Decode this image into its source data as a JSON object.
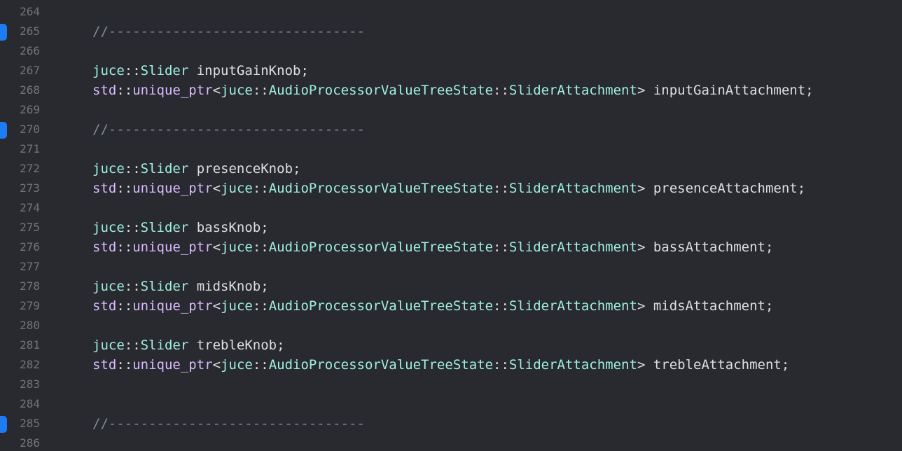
{
  "editor": {
    "colors": {
      "background": "#292a30",
      "line_number": "#747478",
      "change_marker": "#1c7cf4",
      "plain": "#dfdfe0",
      "namespace": "#a6e1ff",
      "std_namespace": "#dabaff",
      "type": "#9ef1dd",
      "comment": "#7f8c98"
    },
    "lines": [
      {
        "num": "264",
        "marker": false,
        "tokens": []
      },
      {
        "num": "265",
        "marker": true,
        "tokens": [
          {
            "t": "//--------------------------------",
            "c": "comment"
          }
        ]
      },
      {
        "num": "266",
        "marker": false,
        "tokens": []
      },
      {
        "num": "267",
        "marker": false,
        "tokens": [
          {
            "t": "juce",
            "c": "type"
          },
          {
            "t": "::",
            "c": "plain"
          },
          {
            "t": "Slider",
            "c": "type"
          },
          {
            "t": " inputGainKnob;",
            "c": "plain"
          }
        ]
      },
      {
        "num": "268",
        "marker": false,
        "tokens": [
          {
            "t": "std",
            "c": "ns2"
          },
          {
            "t": "::",
            "c": "plain"
          },
          {
            "t": "unique_ptr",
            "c": "ns2"
          },
          {
            "t": "<",
            "c": "plain"
          },
          {
            "t": "juce",
            "c": "type"
          },
          {
            "t": "::",
            "c": "plain"
          },
          {
            "t": "AudioProcessorValueTreeState",
            "c": "type"
          },
          {
            "t": "::",
            "c": "plain"
          },
          {
            "t": "SliderAttachment",
            "c": "type"
          },
          {
            "t": "> inputGainAttachment;",
            "c": "plain"
          }
        ]
      },
      {
        "num": "269",
        "marker": false,
        "tokens": []
      },
      {
        "num": "270",
        "marker": true,
        "tokens": [
          {
            "t": "//--------------------------------",
            "c": "comment"
          }
        ]
      },
      {
        "num": "271",
        "marker": false,
        "tokens": []
      },
      {
        "num": "272",
        "marker": false,
        "tokens": [
          {
            "t": "juce",
            "c": "type"
          },
          {
            "t": "::",
            "c": "plain"
          },
          {
            "t": "Slider",
            "c": "type"
          },
          {
            "t": " presenceKnob;",
            "c": "plain"
          }
        ]
      },
      {
        "num": "273",
        "marker": false,
        "tokens": [
          {
            "t": "std",
            "c": "ns2"
          },
          {
            "t": "::",
            "c": "plain"
          },
          {
            "t": "unique_ptr",
            "c": "ns2"
          },
          {
            "t": "<",
            "c": "plain"
          },
          {
            "t": "juce",
            "c": "type"
          },
          {
            "t": "::",
            "c": "plain"
          },
          {
            "t": "AudioProcessorValueTreeState",
            "c": "type"
          },
          {
            "t": "::",
            "c": "plain"
          },
          {
            "t": "SliderAttachment",
            "c": "type"
          },
          {
            "t": "> presenceAttachment;",
            "c": "plain"
          }
        ]
      },
      {
        "num": "274",
        "marker": false,
        "tokens": []
      },
      {
        "num": "275",
        "marker": false,
        "tokens": [
          {
            "t": "juce",
            "c": "type"
          },
          {
            "t": "::",
            "c": "plain"
          },
          {
            "t": "Slider",
            "c": "type"
          },
          {
            "t": " bassKnob;",
            "c": "plain"
          }
        ]
      },
      {
        "num": "276",
        "marker": false,
        "tokens": [
          {
            "t": "std",
            "c": "ns2"
          },
          {
            "t": "::",
            "c": "plain"
          },
          {
            "t": "unique_ptr",
            "c": "ns2"
          },
          {
            "t": "<",
            "c": "plain"
          },
          {
            "t": "juce",
            "c": "type"
          },
          {
            "t": "::",
            "c": "plain"
          },
          {
            "t": "AudioProcessorValueTreeState",
            "c": "type"
          },
          {
            "t": "::",
            "c": "plain"
          },
          {
            "t": "SliderAttachment",
            "c": "type"
          },
          {
            "t": "> bassAttachment;",
            "c": "plain"
          }
        ]
      },
      {
        "num": "277",
        "marker": false,
        "tokens": []
      },
      {
        "num": "278",
        "marker": false,
        "tokens": [
          {
            "t": "juce",
            "c": "type"
          },
          {
            "t": "::",
            "c": "plain"
          },
          {
            "t": "Slider",
            "c": "type"
          },
          {
            "t": " midsKnob;",
            "c": "plain"
          }
        ]
      },
      {
        "num": "279",
        "marker": false,
        "tokens": [
          {
            "t": "std",
            "c": "ns2"
          },
          {
            "t": "::",
            "c": "plain"
          },
          {
            "t": "unique_ptr",
            "c": "ns2"
          },
          {
            "t": "<",
            "c": "plain"
          },
          {
            "t": "juce",
            "c": "type"
          },
          {
            "t": "::",
            "c": "plain"
          },
          {
            "t": "AudioProcessorValueTreeState",
            "c": "type"
          },
          {
            "t": "::",
            "c": "plain"
          },
          {
            "t": "SliderAttachment",
            "c": "type"
          },
          {
            "t": "> midsAttachment;",
            "c": "plain"
          }
        ]
      },
      {
        "num": "280",
        "marker": false,
        "tokens": []
      },
      {
        "num": "281",
        "marker": false,
        "tokens": [
          {
            "t": "juce",
            "c": "type"
          },
          {
            "t": "::",
            "c": "plain"
          },
          {
            "t": "Slider",
            "c": "type"
          },
          {
            "t": " trebleKnob;",
            "c": "plain"
          }
        ]
      },
      {
        "num": "282",
        "marker": false,
        "tokens": [
          {
            "t": "std",
            "c": "ns2"
          },
          {
            "t": "::",
            "c": "plain"
          },
          {
            "t": "unique_ptr",
            "c": "ns2"
          },
          {
            "t": "<",
            "c": "plain"
          },
          {
            "t": "juce",
            "c": "type"
          },
          {
            "t": "::",
            "c": "plain"
          },
          {
            "t": "AudioProcessorValueTreeState",
            "c": "type"
          },
          {
            "t": "::",
            "c": "plain"
          },
          {
            "t": "SliderAttachment",
            "c": "type"
          },
          {
            "t": "> trebleAttachment;",
            "c": "plain"
          }
        ]
      },
      {
        "num": "283",
        "marker": false,
        "tokens": []
      },
      {
        "num": "284",
        "marker": false,
        "tokens": []
      },
      {
        "num": "285",
        "marker": true,
        "tokens": [
          {
            "t": "//--------------------------------",
            "c": "comment"
          }
        ]
      },
      {
        "num": "286",
        "marker": false,
        "tokens": []
      }
    ]
  }
}
